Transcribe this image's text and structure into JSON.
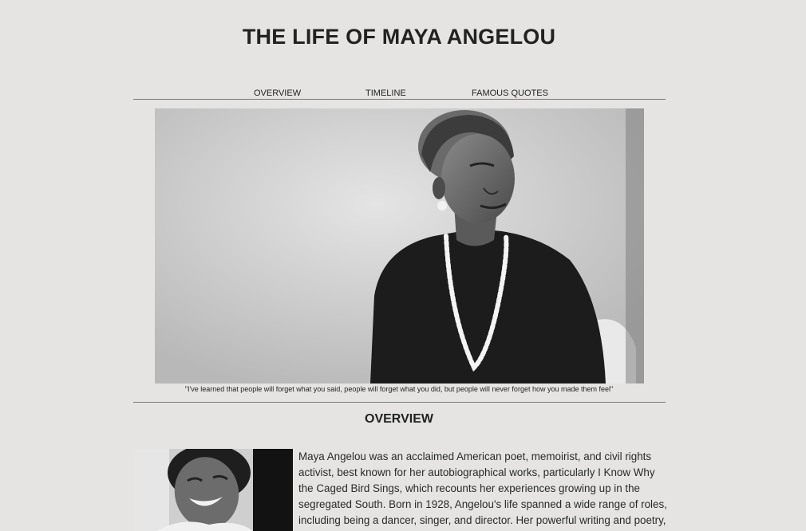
{
  "page": {
    "title": "THE LIFE OF MAYA ANGELOU"
  },
  "nav": {
    "items": [
      {
        "label": "OVERVIEW"
      },
      {
        "label": "TIMELINE"
      },
      {
        "label": "FAMOUS QUOTES"
      }
    ]
  },
  "hero": {
    "image": "black-and-white photo of Maya Angelou in dark sweater and pearl necklace",
    "caption": "\"I've learned that people will forget what you said, people will forget what you did, but people will never forget how you made them feel\""
  },
  "overview": {
    "heading": "OVERVIEW",
    "image": "black-and-white photo of Maya Angelou laughing",
    "text": "Maya Angelou was an acclaimed American poet, memoirist, and civil rights activist, best known for her autobiographical works, particularly I Know Why the Caged Bird Sings, which recounts her experiences growing up in the segregated South. Born in 1928, Angelou's life spanned a wide range of roles, including being a dancer, singer, and director. Her powerful writing and poetry,"
  },
  "colors": {
    "background": "#e5e4e2",
    "text": "#222222",
    "rule": "#777777"
  }
}
